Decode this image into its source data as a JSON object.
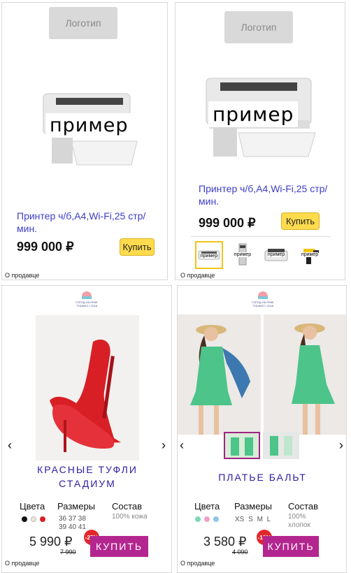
{
  "ad1": {
    "logo": "Логотип",
    "image_label": "пример",
    "title": "Принтер ч/б,A4,Wi-Fi,25 стр/мин.",
    "price": "999 000 ₽",
    "buy": "Купить",
    "seller": "О продавце"
  },
  "ad2": {
    "logo": "Логотип",
    "image_label": "пример",
    "title": "Принтер ч/б,A4,Wi-Fi,25 стр/мин.",
    "price": "999 000 ₽",
    "buy": "Купить",
    "thumb_labels": [
      "пример",
      "пример",
      "пример",
      "пример"
    ],
    "seller": "О продавце"
  },
  "ad3": {
    "brand": "ГОРОД НА РЕКЕ ТУШИНО • 2018",
    "title_line1": "КРАСНЫЕ ТУФЛИ",
    "title_line2": "СТАДИУМ",
    "colors_label": "Цвета",
    "sizes_label": "Размеры",
    "composition_label": "Состав",
    "color_dots": [
      "#111111",
      "#ece7d8",
      "#d81f26"
    ],
    "sizes_row1": "36 37 38",
    "sizes_row2": "39 40 41",
    "composition": "100% кожа",
    "price": "5 990 ₽",
    "old_price": "7 990",
    "discount": "-25%",
    "buy": "КУПИТЬ",
    "seller": "О продавце"
  },
  "ad4": {
    "brand": "ГОРОД НА РЕКЕ ТУШИНО • 2018",
    "title": "ПЛАТЬЕ БАЛЬТ",
    "colors_label": "Цвета",
    "sizes_label": "Размеры",
    "composition_label": "Состав",
    "color_dots": [
      "#7fd8b8",
      "#f0a0c8",
      "#8ec5e8"
    ],
    "sizes": "XS S M L",
    "composition_line1": "100%",
    "composition_line2": "хлопок",
    "price": "3 580 ₽",
    "old_price": "4 090",
    "discount": "-12%",
    "buy": "КУПИТЬ",
    "seller": "О продавце"
  }
}
